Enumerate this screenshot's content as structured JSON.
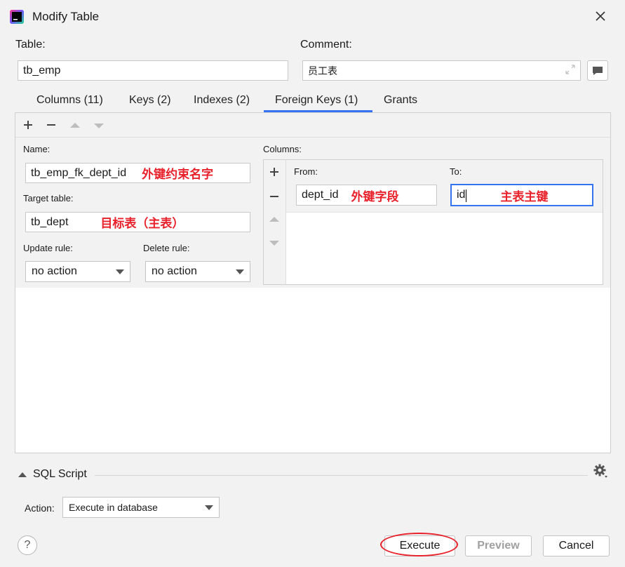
{
  "window": {
    "title": "Modify Table"
  },
  "table": {
    "label": "Table:",
    "value": "tb_emp"
  },
  "comment": {
    "label": "Comment:",
    "value": "员工表"
  },
  "tabs": [
    {
      "label": "Columns (11)"
    },
    {
      "label": "Keys (2)"
    },
    {
      "label": "Indexes (2)"
    },
    {
      "label": "Foreign Keys (1)"
    },
    {
      "label": "Grants"
    }
  ],
  "active_tab": "Foreign Keys (1)",
  "fk": {
    "name_label": "Name:",
    "name_value": "tb_emp_fk_dept_id",
    "name_note": "外键约束名字",
    "target_label": "Target table:",
    "target_value": "tb_dept",
    "target_note": "目标表（主表）",
    "update_label": "Update rule:",
    "update_value": "no action",
    "delete_label": "Delete rule:",
    "delete_value": "no action",
    "columns_label": "Columns:",
    "from_label": "From:",
    "to_label": "To:",
    "from_value": "dept_id",
    "from_note": "外键字段",
    "to_value": "id",
    "to_note": "主表主键"
  },
  "sql": {
    "label": "SQL Script"
  },
  "action": {
    "label": "Action:",
    "value": "Execute in database"
  },
  "buttons": {
    "help": "?",
    "execute": "Execute",
    "preview": "Preview",
    "cancel": "Cancel"
  },
  "colors": {
    "accent": "#3574f0",
    "annotation": "#e8212b"
  }
}
